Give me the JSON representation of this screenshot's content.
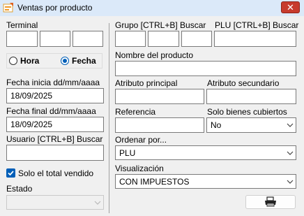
{
  "window": {
    "title": "Ventas por producto",
    "close_label": "✕"
  },
  "left": {
    "terminal_label": "Terminal",
    "time_mode": {
      "hora_label": "Hora",
      "fecha_label": "Fecha",
      "selected": "Fecha"
    },
    "start_date_label": "Fecha inicia dd/mm/aaaa",
    "start_date_value": "18/09/2025",
    "end_date_label": "Fecha final dd/mm/aaaa",
    "end_date_value": "18/09/2025",
    "user_label": "Usuario [CTRL+B] Buscar",
    "user_value": "",
    "only_total_sold_label": "Solo el total vendido",
    "only_total_sold_checked": true,
    "state_label": "Estado",
    "state_value": ""
  },
  "right": {
    "group_label": "Grupo [CTRL+B] Buscar",
    "plu_label": "PLU [CTRL+B] Buscar",
    "product_name_label": "Nombre del producto",
    "main_attr_label": "Atributo principal",
    "secondary_attr_label": "Atributo secundario",
    "reference_label": "Referencia",
    "covered_goods_label": "Solo bienes cubiertos",
    "covered_goods_value": "No",
    "order_by_label": "Ordenar por...",
    "order_by_value": "PLU",
    "view_label": "Visualización",
    "view_value": "CON IMPUESTOS"
  },
  "icons": {
    "app": "report-icon",
    "print": "printer-icon",
    "dropdown": "chevron-down-icon"
  },
  "colors": {
    "accent": "#005fb8",
    "close": "#c73b2d",
    "titlebar": "#dbe9f9"
  }
}
